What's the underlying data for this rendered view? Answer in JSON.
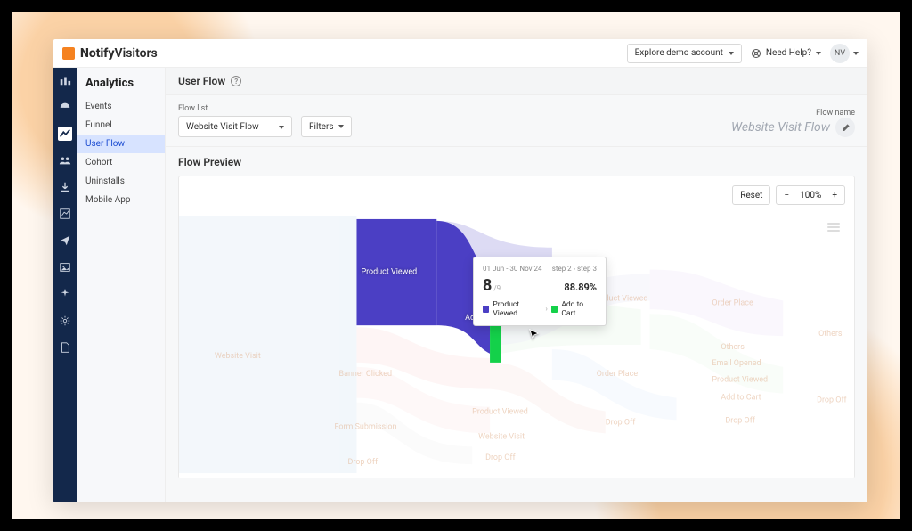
{
  "brand": {
    "bold": "Notify",
    "light": "Visitors"
  },
  "topbar": {
    "explore_btn": "Explore demo account",
    "need_help": "Need Help?",
    "avatar_initials": "NV"
  },
  "icon_rail": [
    "bar-chart-icon",
    "dashboard-icon",
    "line-chart-icon",
    "group-icon",
    "download-icon",
    "chart2-icon",
    "send-icon",
    "image-icon",
    "spark-icon",
    "gear-icon",
    "doc-icon"
  ],
  "sub_sidebar": {
    "title": "Analytics",
    "items": [
      "Events",
      "Funnel",
      "User Flow",
      "Cohort",
      "Uninstalls",
      "Mobile App"
    ],
    "active_index": 2
  },
  "main": {
    "header": "User Flow",
    "flow_list_label": "Flow list",
    "flow_list_selected": "Website Visit Flow",
    "filters_label": "Filters",
    "flow_name_label": "Flow name",
    "flow_name_value": "Website Visit Flow"
  },
  "preview": {
    "title": "Flow Preview",
    "reset": "Reset",
    "zoom_minus": "−",
    "zoom_value": "100%",
    "zoom_plus": "+"
  },
  "tooltip": {
    "date_range": "01 Jun - 30 Nov 24",
    "step_label": "step 2 › step 3",
    "count": "8",
    "of": "/9",
    "pct": "88.89%",
    "from_label": "Product Viewed",
    "to_label": "Add to Cart"
  },
  "sankey_labels": {
    "product_viewed": "Product Viewed",
    "add_to_cart": "Add to Cart"
  },
  "ghost_labels": [
    "Website Visit",
    "Banner Clicked",
    "Form Submission",
    "Drop Off",
    "Product Viewed",
    "Website Visit",
    "Drop Off",
    "Product Viewed",
    "Order Place",
    "Drop Off",
    "Order Place",
    "Others",
    "Email Opened",
    "Product Viewed",
    "Add to Cart",
    "Drop Off",
    "Others",
    "Drop Off"
  ],
  "chart_data": {
    "type": "sankey",
    "date_range": "01 Jun - 30 Nov 24",
    "step": "step 2 to step 3",
    "highlighted_link": {
      "from": "Product Viewed",
      "to": "Add to Cart",
      "value": 8,
      "total_from_source": 9,
      "pct": 88.89
    },
    "nodes_step1": [
      "Website Visit",
      "Banner Clicked",
      "Form Submission",
      "Drop Off"
    ],
    "nodes_step2": [
      "Product Viewed",
      "Add to Cart",
      "Product Viewed",
      "Website Visit",
      "Drop Off"
    ],
    "nodes_step3": [
      "Product Viewed",
      "Order Place",
      "Drop Off"
    ],
    "nodes_step4": [
      "Order Place",
      "Others",
      "Email Opened",
      "Product Viewed",
      "Add to Cart",
      "Drop Off"
    ],
    "nodes_step5": [
      "Others",
      "Drop Off"
    ]
  }
}
